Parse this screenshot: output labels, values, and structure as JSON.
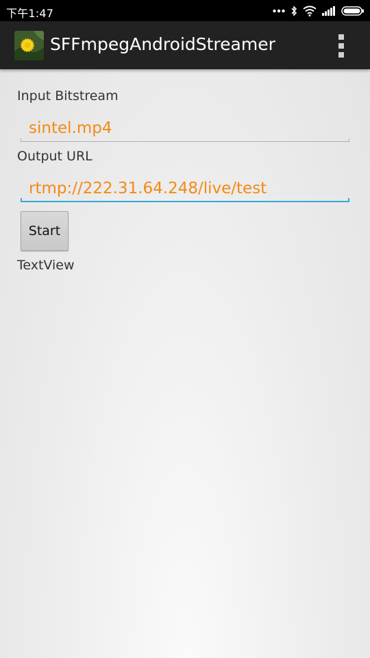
{
  "status_bar": {
    "time": "下午1:47",
    "icons": [
      "more-dots-icon",
      "bluetooth-icon",
      "wifi-icon",
      "signal-icon",
      "battery-icon"
    ]
  },
  "action_bar": {
    "app_icon": "dandelion-app-icon",
    "title": "SFFmpegAndroidStreamer",
    "menu_icon": "overflow-menu-icon"
  },
  "form": {
    "input_label": "Input Bitstream",
    "input_value": "sintel.mp4",
    "output_label": "Output URL",
    "output_value": "rtmp://222.31.64.248/live/test",
    "start_label": "Start",
    "text_view": "TextView"
  },
  "colors": {
    "field_text": "#f38a14",
    "focus_underline": "#33a8d8",
    "action_bar": "#222222",
    "status_bar": "#000000"
  }
}
